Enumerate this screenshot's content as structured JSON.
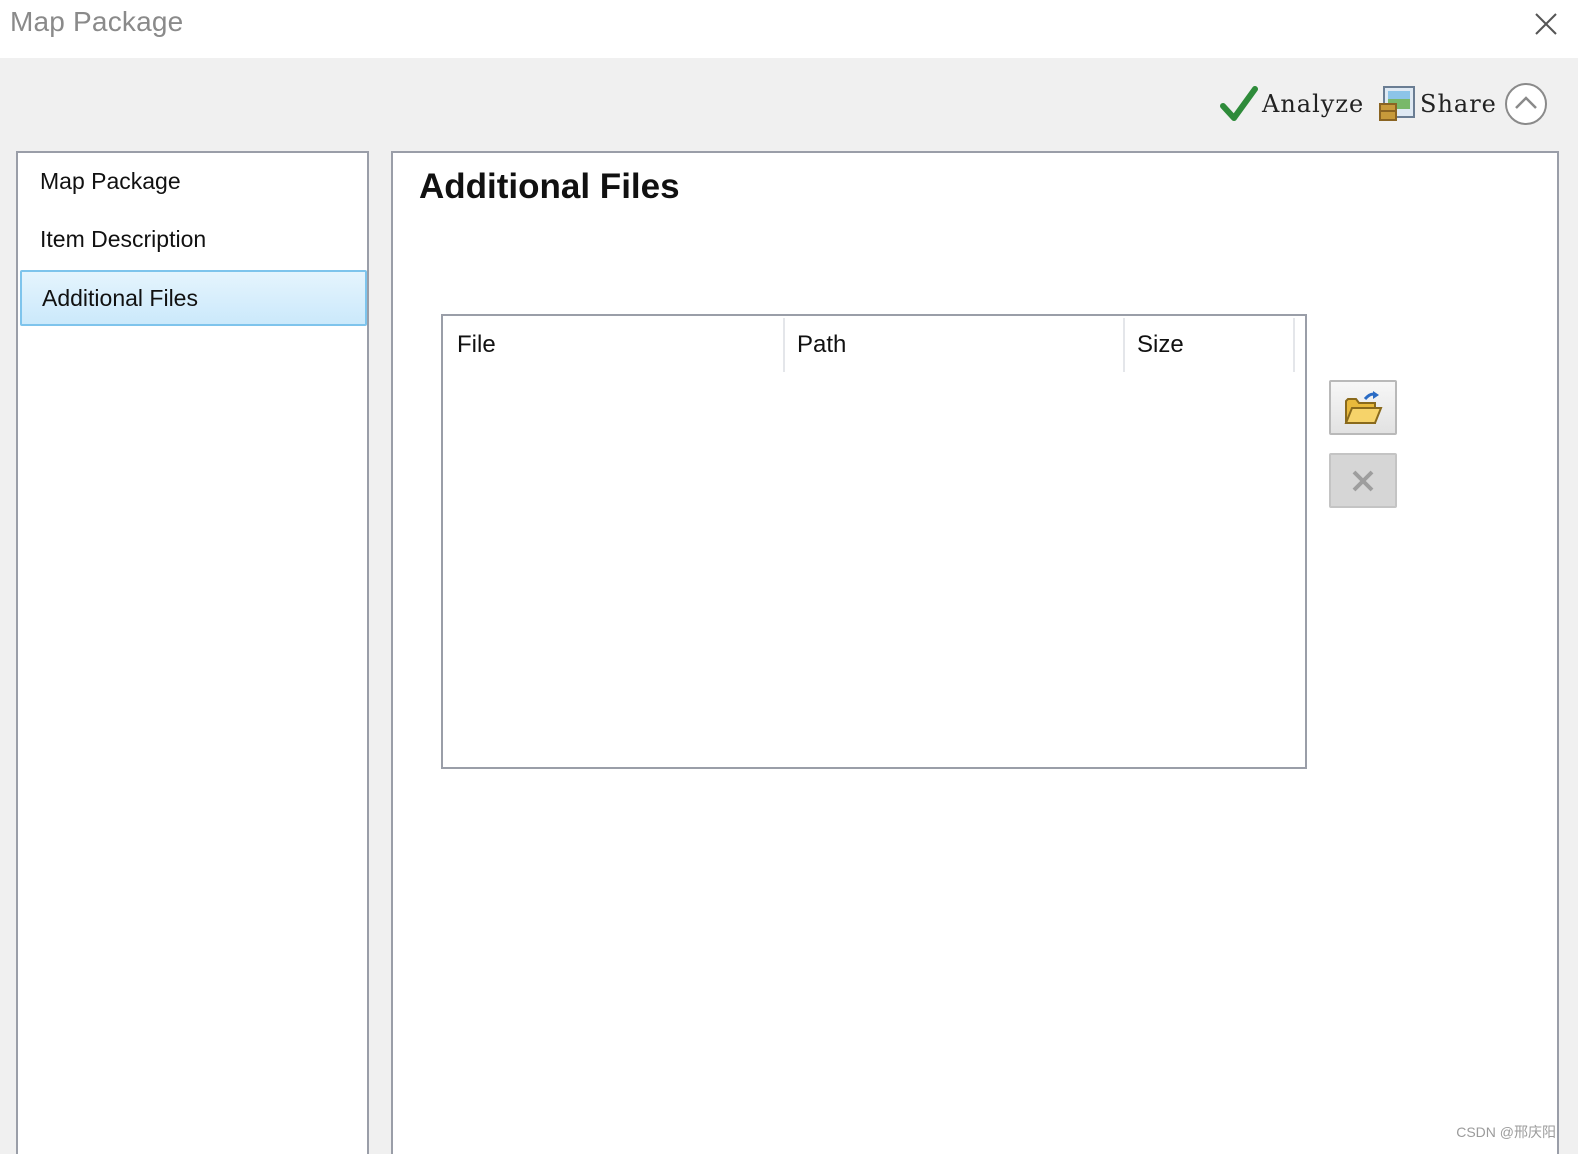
{
  "window": {
    "title": "Map Package",
    "close_icon": "close-icon"
  },
  "toolbar": {
    "analyze_label": "Analyze",
    "analyze_icon": "checkmark-icon",
    "share_label": "Share",
    "share_icon": "share-package-icon",
    "collapse_icon": "chevron-up-circle-icon"
  },
  "sidebar": {
    "items": [
      {
        "label": "Map Package",
        "selected": false
      },
      {
        "label": "Item Description",
        "selected": false
      },
      {
        "label": "Additional Files",
        "selected": true
      }
    ]
  },
  "main": {
    "title": "Additional Files",
    "table": {
      "columns": [
        "File",
        "Path",
        "Size"
      ],
      "rows": []
    },
    "buttons": {
      "add_icon": "open-folder-icon",
      "remove_icon": "remove-x-icon"
    }
  },
  "watermark": "CSDN @邢庆阳",
  "colors": {
    "accent_selected_border": "#7ec4ec",
    "accent_selected_fill": "#cbe9fb",
    "checkmark_green": "#2e8b3a",
    "panel_border": "#9a9ea8",
    "background": "#f0f0f0"
  }
}
